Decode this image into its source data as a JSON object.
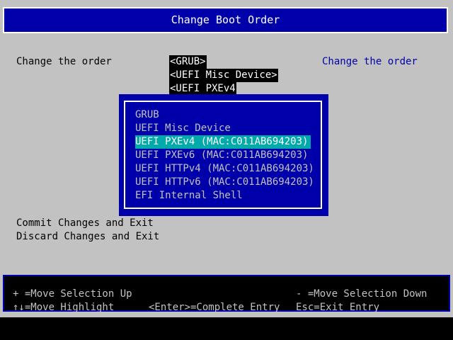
{
  "header": {
    "title": "Change Boot Order"
  },
  "main": {
    "left_label": "Change the order",
    "right_help": "Change the order",
    "order_items": [
      "<GRUB>",
      "<UEFI Misc Device>",
      "<UEFI PXEv4"
    ],
    "commit": "Commit Changes and Exit",
    "discard": "Discard Changes and Exit"
  },
  "popup": {
    "items": [
      "GRUB",
      "UEFI Misc Device",
      "UEFI PXEv4 (MAC:C011AB694203)",
      "UEFI PXEv6 (MAC:C011AB694203)",
      "UEFI HTTPv4 (MAC:C011AB694203)",
      "UEFI HTTPv6 (MAC:C011AB694203)",
      "EFI Internal Shell"
    ],
    "selected_index": 2
  },
  "footer": {
    "line1_left": "+ =Move Selection Up",
    "line1_right": "- =Move Selection Down",
    "line2_left": "↑↓=Move Highlight",
    "line2_mid": "<Enter>=Complete Entry",
    "line2_right": "Esc=Exit Entry"
  },
  "colors": {
    "background": "#c2c2c2",
    "panel_blue": "#0000aa",
    "highlight": "#00aaaa",
    "text_black": "#000000",
    "text_white": "#ffffff"
  }
}
